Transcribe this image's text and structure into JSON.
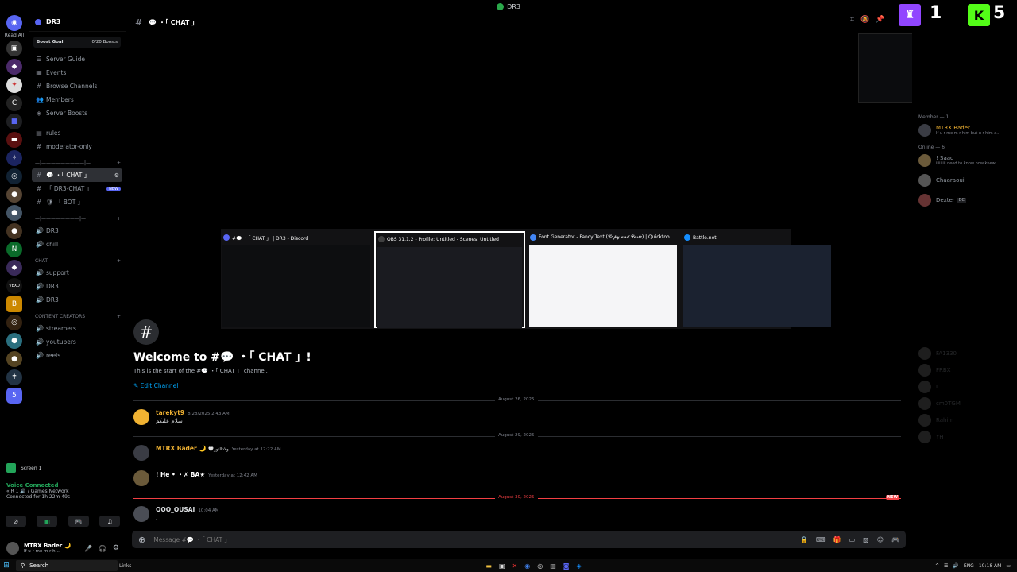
{
  "window": {
    "title": "DR3"
  },
  "rail": {
    "readall": "Read All"
  },
  "server": {
    "name": "DR3",
    "boost_label": "Boost Goal",
    "boost_value": "0/20 Boosts"
  },
  "nav": [
    {
      "icon": "guide-icon",
      "glyph": "☰",
      "label": "Server Guide"
    },
    {
      "icon": "events-icon",
      "glyph": "▦",
      "label": "Events"
    },
    {
      "icon": "browse-icon",
      "glyph": "#",
      "label": "Browse Channels"
    },
    {
      "icon": "members-icon",
      "glyph": "👥",
      "label": "Members"
    },
    {
      "icon": "boost-icon",
      "glyph": "◈",
      "label": "Server Boosts"
    }
  ],
  "channels_top": [
    {
      "glyph": "▤",
      "label": "rules"
    },
    {
      "glyph": "#",
      "label": "moderator-only"
    }
  ],
  "category1": "—|—————————|—",
  "channels_chat": [
    {
      "glyph": "#",
      "label": "💬 ・「 CHAT 」",
      "active": true
    },
    {
      "glyph": "#",
      "label": "「 DR3-CHAT 」",
      "badge": "NEW"
    },
    {
      "glyph": "#",
      "label": "🛡 「 BOT 」"
    }
  ],
  "category2": "—|————————|—",
  "channels_voice": [
    {
      "glyph": "🔊",
      "label": "DR3"
    },
    {
      "glyph": "🔊",
      "label": "chill"
    }
  ],
  "category3": "CHAT",
  "channels_chat2": [
    {
      "glyph": "🔊",
      "label": "support"
    },
    {
      "glyph": "🔊",
      "label": "DR3"
    },
    {
      "glyph": "🔊",
      "label": "DR3"
    }
  ],
  "category4": "CONTENT CREATORS",
  "channels_creators": [
    {
      "glyph": "🔊",
      "label": "streamers"
    },
    {
      "glyph": "🔊",
      "label": "youtubers"
    },
    {
      "glyph": "🔊",
      "label": "reels"
    }
  ],
  "voice": {
    "screen": "Screen 1",
    "status": "Voice Connected",
    "channel": "« R 1 🔊 / Games Network",
    "duration": "Connected for 1h 22m 49s"
  },
  "user": {
    "name": "MTRX Bader 🌙",
    "status": "If u r me m r h..."
  },
  "channel_header": {
    "title": "💬 ・「 CHAT 」"
  },
  "welcome": {
    "title": "Welcome to #💬 ・「 CHAT 」!",
    "subtitle": "This is the start of the #💬 ・「 CHAT 」 channel.",
    "edit": "Edit Channel"
  },
  "dividers": {
    "d1": "August 26, 2025",
    "d2": "August 29, 2025",
    "d3": "August 30, 2025",
    "new": "NEW"
  },
  "messages": [
    {
      "author": "tarekyt9",
      "ts": "8/28/2025 2:43 AM",
      "body": "سلام عليكم",
      "color": "#f0b232"
    },
    {
      "author": "MTRX Bader 🌙",
      "tag": "🤍ولادالنور",
      "ts": "Yesterday at 12:22 AM",
      "body": ".",
      "color": "#f0b232"
    },
    {
      "author": "! He • ・✗ BA★",
      "ts": "Yesterday at 12:42 AM",
      "body": ".",
      "color": "#ffffff"
    },
    {
      "author": "QQQ_QUSAI",
      "ts": "10:04 AM",
      "body": ".",
      "color": "#dbdee1"
    }
  ],
  "composer": {
    "placeholder": "Message #💬 ・「 CHAT 」"
  },
  "members": {
    "member_cat": "Member — 1",
    "online_cat": "Online — 6",
    "list": [
      {
        "name": "MTRX Bader ...",
        "status": "If u r me m r him but u r him a...",
        "color": "#f0b232"
      },
      {
        "name": "! Saad",
        "status": "iiiiiiiii need to know how knew...",
        "color": "#949ba4"
      },
      {
        "name": "Chaaraoui",
        "status": "",
        "color": "#949ba4"
      },
      {
        "name": "Dexter",
        "status": "",
        "color": "#949ba4",
        "tag": "DC"
      }
    ],
    "dim": [
      "FA1330",
      "FRBX",
      "L",
      "cm0TGM",
      "Rahim",
      "YH"
    ]
  },
  "overlay": {
    "n1": "1",
    "n2": "5"
  },
  "switcher": {
    "windows": [
      {
        "title": "#💬 ・「 CHAT 」 | DR3 - Discord",
        "color": "#5865f2",
        "thumb": "#0d0e10"
      },
      {
        "title": "OBS 31.1.2 - Profile: Untitled - Scenes: Untitled",
        "color": "#404040",
        "thumb": "#1a1b20",
        "selected": true
      },
      {
        "title": "Font Generator - Fancy Text (𝒞𝑜𝓅𝓎 𝒶𝓃𝒹 𝒫𝒶𝓈𝓉𝑒) | Quicktoo...",
        "color": "#4285f4",
        "thumb": "#f5f5f7"
      },
      {
        "title": "Battle.net",
        "color": "#148eff",
        "thumb": "#1b2230"
      }
    ]
  },
  "taskbar": {
    "search": "Search",
    "links": "Links",
    "lang": "ENG",
    "time": "10:18 AM"
  }
}
